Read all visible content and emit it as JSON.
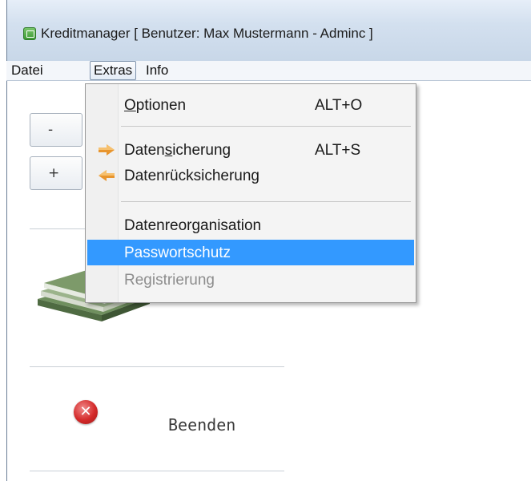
{
  "window": {
    "title": "Kreditmanager [ Benutzer: Max Mustermann - Adminc ]"
  },
  "menubar": {
    "items": [
      {
        "label": "Datei"
      },
      {
        "label": "Extras"
      },
      {
        "label": "Info"
      }
    ]
  },
  "side_panel": {
    "minus_button": "-",
    "plus_button": "+",
    "exit_label": "Beenden",
    "exit_icon_glyph": "✕"
  },
  "extras_menu": {
    "items": [
      {
        "label": "Optionen",
        "underline": "O",
        "shortcut": "ALT+O",
        "icon": ""
      },
      {
        "label": "Datensicherung",
        "underline": "s",
        "shortcut": "ALT+S",
        "icon": "arrow-right-icon"
      },
      {
        "label": "Datenrücksicherung",
        "shortcut": "",
        "icon": "arrow-left-icon"
      },
      {
        "label": "Datenreorganisation",
        "shortcut": "",
        "icon": ""
      },
      {
        "label": "Passwortschutz",
        "shortcut": "",
        "icon": "",
        "state": "highlighted"
      },
      {
        "label": "Registrierung",
        "shortcut": "",
        "icon": "",
        "state": "disabled"
      }
    ]
  },
  "colors": {
    "highlight": "#3399ff",
    "disabled_text": "#8d8d8d",
    "arrow_icon": "#e8952e"
  }
}
